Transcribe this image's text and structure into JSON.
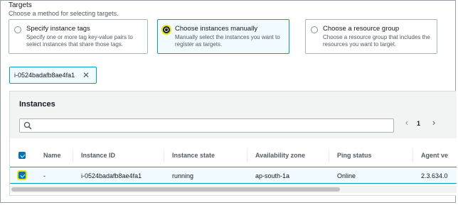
{
  "targets": {
    "title": "Targets",
    "description": "Choose a method for selecting targets.",
    "options": [
      {
        "title": "Specify instance tags",
        "description": "Specify one or more tag key-value pairs to select instances that share those tags."
      },
      {
        "title": "Choose instances manually",
        "description": "Manually select the instances you want to register as targets."
      },
      {
        "title": "Choose a resource group",
        "description": "Choose a resource group that includes the resources you want to target."
      }
    ],
    "selected_option": "Choose instances manually"
  },
  "token": {
    "label": "i-0524badafb8ae4fa1",
    "remove_icon": "close-icon"
  },
  "instances": {
    "title": "Instances",
    "search": {
      "placeholder": "",
      "value": ""
    },
    "pagination": {
      "page": "1"
    },
    "columns": [
      "Name",
      "Instance ID",
      "Instance state",
      "Availability zone",
      "Ping status",
      "Agent ve"
    ],
    "rows": [
      {
        "selected": true,
        "name": "-",
        "instance_id": "i-0524badafb8ae4fa1",
        "state": "running",
        "zone": "ap-south-1a",
        "ping": "Online",
        "agent": "2.3.634.0"
      }
    ]
  },
  "colors": {
    "accent": "#0073bb",
    "selection_border": "#00a1c9",
    "selection_bg": "#f1faff"
  }
}
